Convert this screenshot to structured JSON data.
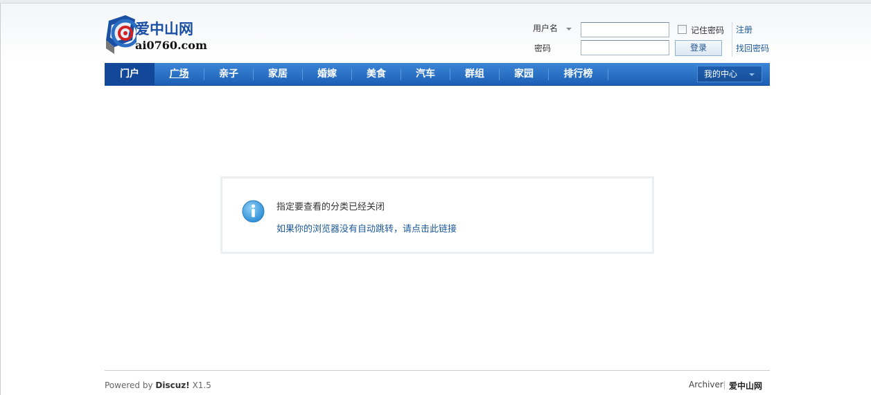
{
  "logo": {
    "name": "爱中山网",
    "domain": "ai0760.com"
  },
  "login": {
    "username_label": "用户名",
    "password_label": "密码",
    "remember_label": "记住密码",
    "login_button": "登录",
    "register_link": "注册",
    "recover_link": "找回密码"
  },
  "nav": {
    "items": [
      "门户",
      "广场",
      "亲子",
      "家居",
      "婚嫁",
      "美食",
      "汽车",
      "群组",
      "家园",
      "排行榜"
    ],
    "my_center": "我的中心"
  },
  "message": {
    "title": "指定要查看的分类已经关闭",
    "redirect_link": "如果你的浏览器没有自动跳转，请点击此链接"
  },
  "footer": {
    "powered_prefix": "Powered by",
    "powered_brand": "Discuz!",
    "powered_version": "X1.5",
    "archiver": "Archiver",
    "site_name": "爱中山网"
  },
  "colors": {
    "nav_blue": "#1c5fb6",
    "nav_active": "#12479a",
    "link_blue": "#1d5a9a",
    "logo_blue": "#1a4fa3",
    "info_icon": "#3b9ee0"
  }
}
